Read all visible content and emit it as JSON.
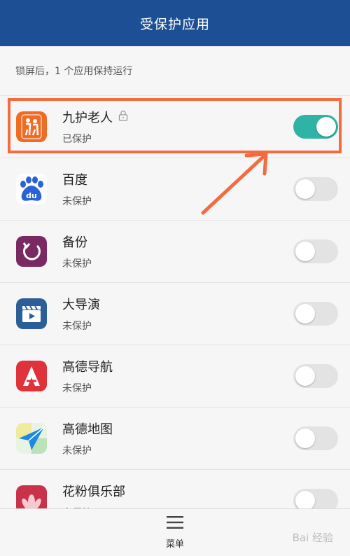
{
  "header": {
    "title": "受保护应用"
  },
  "subtitle": "锁屏后，1 个应用保持运行",
  "apps": [
    {
      "name": "九护老人",
      "status": "已保护",
      "enabled": true,
      "locked": true,
      "icon": "elderly-care-icon",
      "color": "#ef6c24"
    },
    {
      "name": "百度",
      "status": "未保护",
      "enabled": false,
      "icon": "baidu-paw-icon",
      "color": "#2a63d6"
    },
    {
      "name": "备份",
      "status": "未保护",
      "enabled": false,
      "icon": "backup-icon",
      "color": "#7a2a63"
    },
    {
      "name": "大导演",
      "status": "未保护",
      "enabled": false,
      "icon": "video-clapper-icon",
      "color": "#2c5f9a"
    },
    {
      "name": "高德导航",
      "status": "未保护",
      "enabled": false,
      "icon": "amap-navigation-icon",
      "color": "#e0323a"
    },
    {
      "name": "高德地图",
      "status": "未保护",
      "enabled": false,
      "icon": "amap-paper-plane-icon",
      "color": "#1e88e5"
    },
    {
      "name": "花粉俱乐部",
      "status": "未保护",
      "enabled": false,
      "icon": "lotus-flower-icon",
      "color": "#c8334a"
    }
  ],
  "bottom_bar": {
    "menu_label": "菜单"
  },
  "watermark": "Bai 经验",
  "colors": {
    "header": "#1d4f95",
    "toggle_on": "#2fb3a6",
    "highlight": "#f36b3f"
  }
}
